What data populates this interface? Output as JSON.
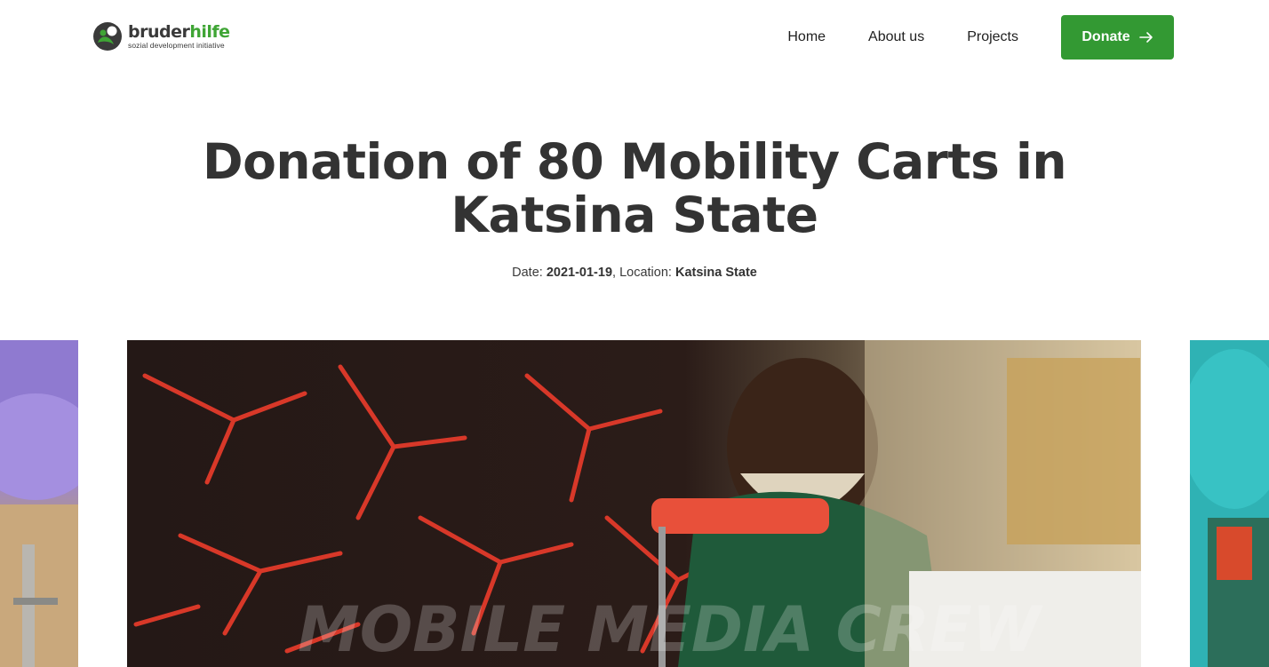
{
  "brand": {
    "name_part1": "bruder",
    "name_part2": "hilfe",
    "tagline": "sozial development initiative",
    "colors": {
      "green": "#3fa535",
      "dark": "#3a3a3a"
    }
  },
  "nav": {
    "items": [
      {
        "label": "Home"
      },
      {
        "label": "About us"
      },
      {
        "label": "Projects"
      }
    ],
    "donate_label": "Donate",
    "donate_icon": "arrow-right-icon",
    "donate_color": "#339933"
  },
  "article": {
    "title": "Donation of 80 Mobility Carts in Katsina State",
    "date_label": "Date:",
    "date": "2021-01-19",
    "location_label": "Location:",
    "location": "Katsina State"
  },
  "carousel": {
    "watermark": "MOBILE MEDIA CREW"
  }
}
